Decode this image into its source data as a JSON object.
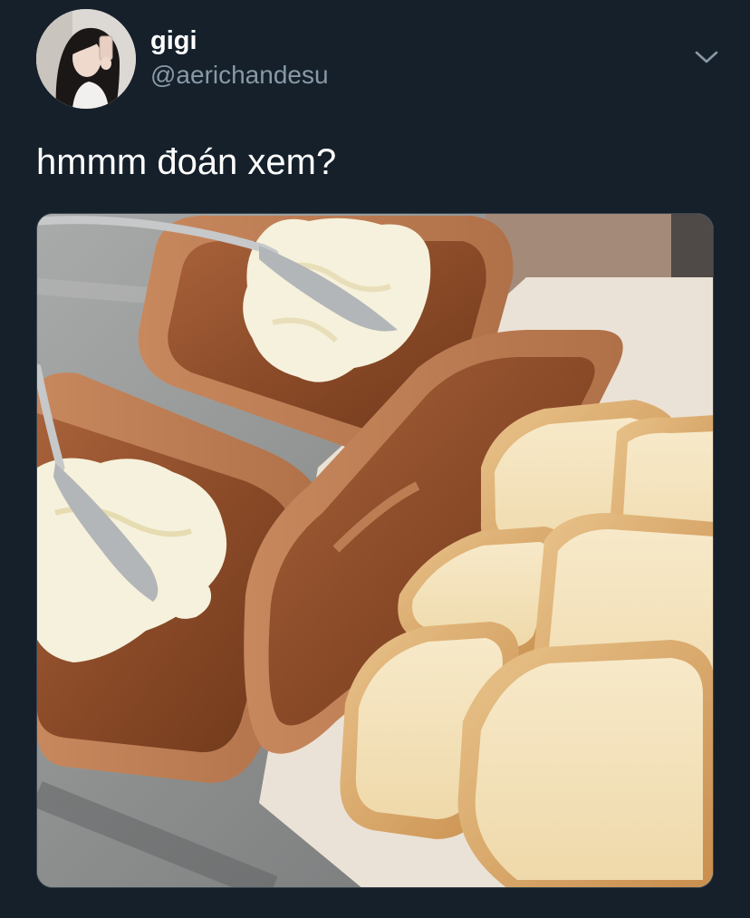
{
  "tweet": {
    "author": {
      "display_name": "gigi",
      "handle": "@aerichandesu",
      "avatar_icon": "profile-photo"
    },
    "menu_icon": "chevron-down-icon",
    "text": "hmmm đoán xem?",
    "media": {
      "type": "photo"
    }
  },
  "colors": {
    "background": "#15202b",
    "primary_text": "#ffffff",
    "secondary_text": "#8899a6",
    "border": "#38444d"
  }
}
